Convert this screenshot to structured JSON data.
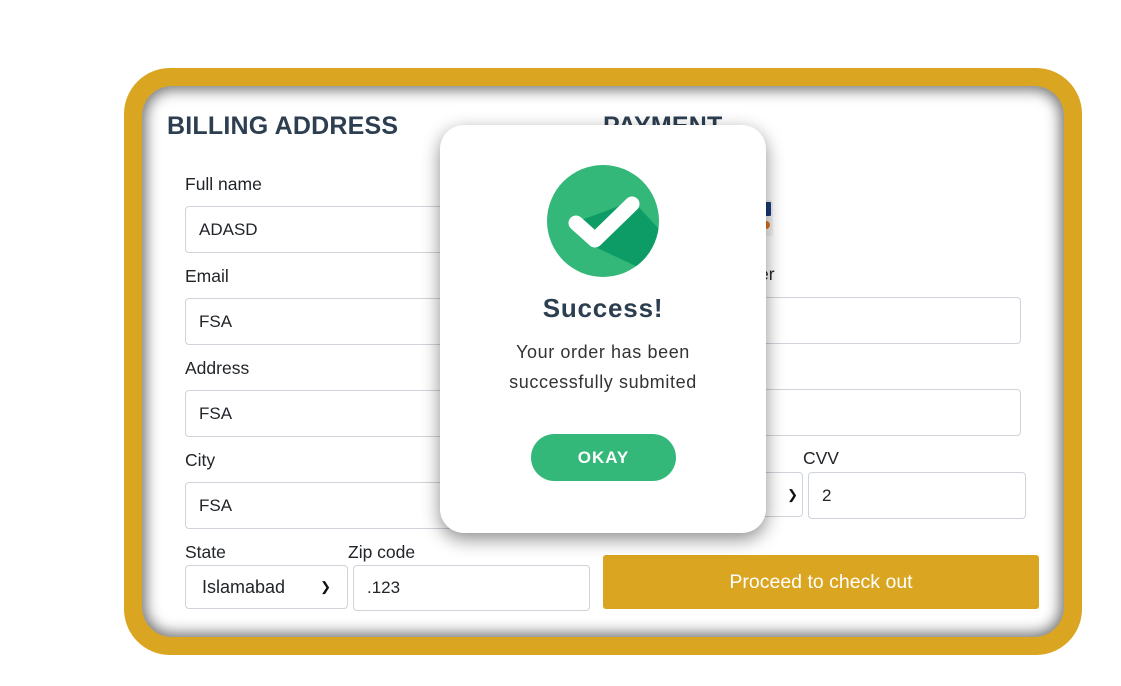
{
  "billing": {
    "heading": "BILLING ADDRESS",
    "full_name": {
      "label": "Full name",
      "value": "ADASD"
    },
    "email": {
      "label": "Email",
      "value": "FSA"
    },
    "address": {
      "label": "Address",
      "value": "FSA"
    },
    "city": {
      "label": "City",
      "value": "FSA"
    },
    "state": {
      "label": "State",
      "value": "Islamabad"
    },
    "zip": {
      "label": "Zip code",
      "value": ".123"
    }
  },
  "payment": {
    "heading": "PAYMENT",
    "card_number_label_partial": "er",
    "cvv": {
      "label": "CVV",
      "value": "2"
    },
    "proceed_label": "Proceed to check out"
  },
  "modal": {
    "title": "Success!",
    "message": "Your order has been successfully submited",
    "ok_label": "OKAY"
  },
  "colors": {
    "accent": "#daa520",
    "success": "#33b87a",
    "heading": "#2c3e50"
  }
}
